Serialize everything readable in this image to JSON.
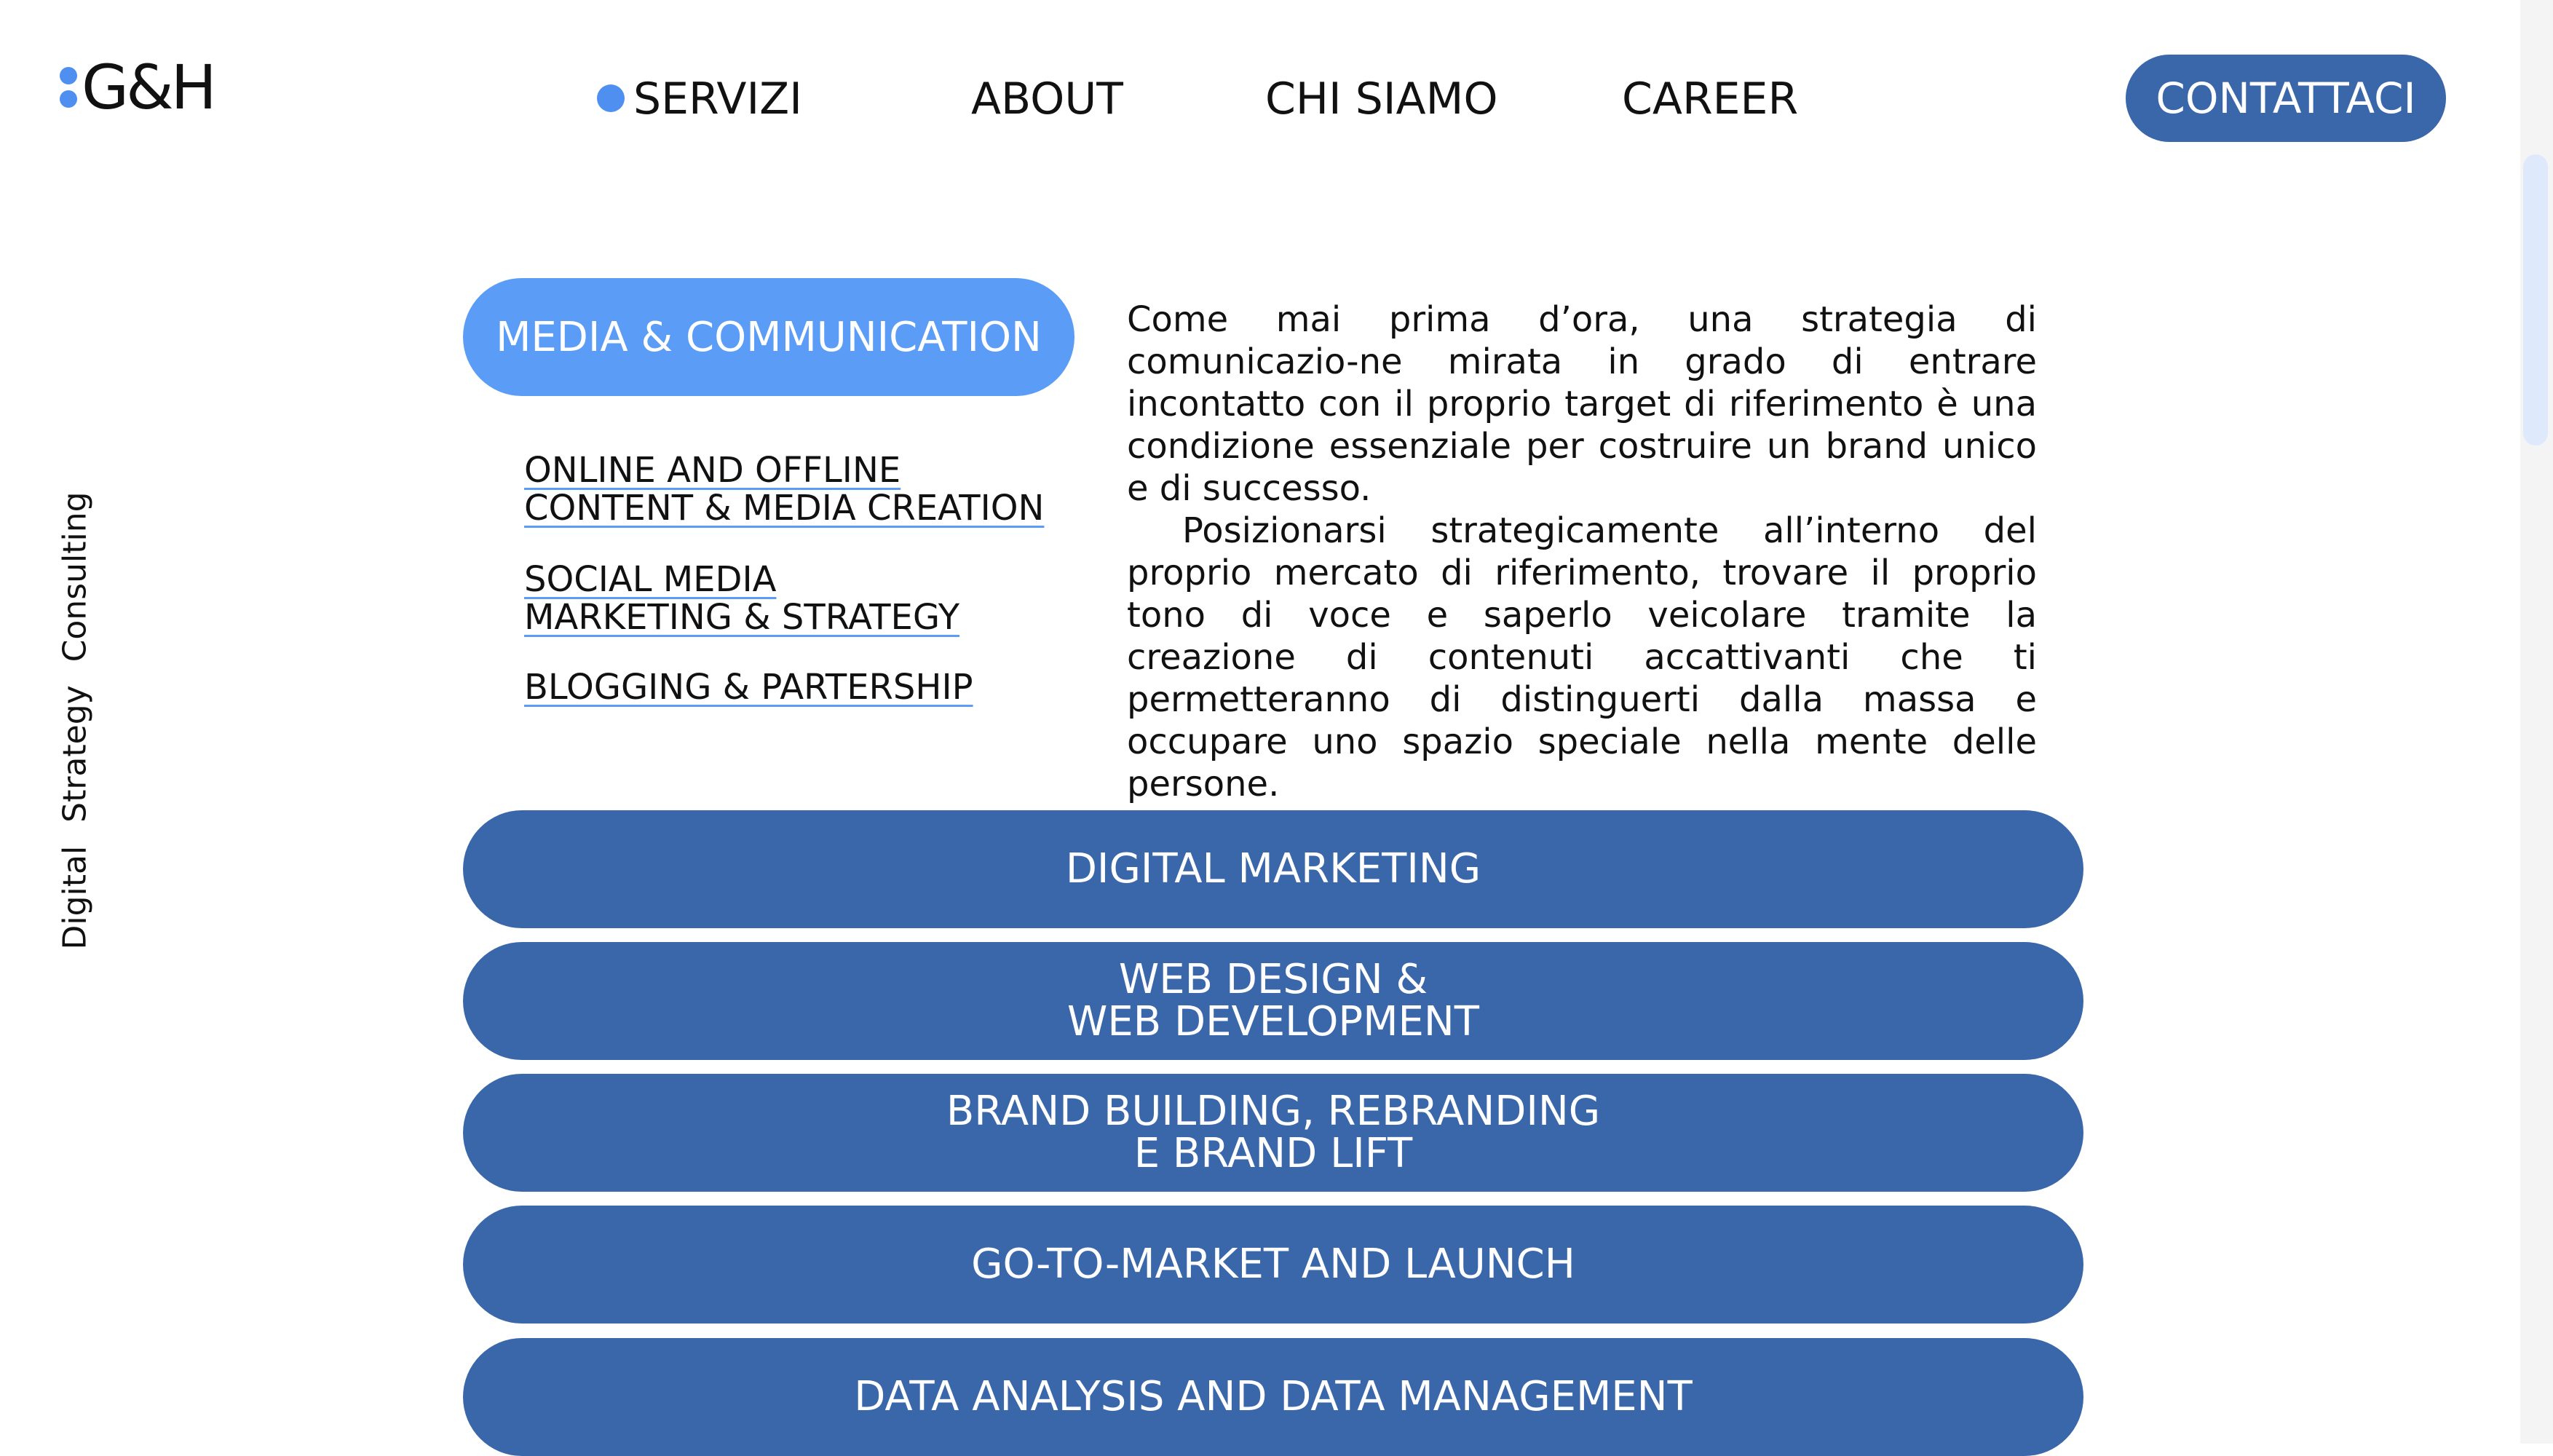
{
  "logo": {
    "text": "G&H"
  },
  "nav": {
    "items": [
      {
        "label": "SERVIZI",
        "active": true
      },
      {
        "label": "ABOUT"
      },
      {
        "label": "CHI SIAMO"
      },
      {
        "label": "CAREER"
      }
    ],
    "contact_label": "CONTATTACI"
  },
  "side_text": "Digital Strategy Consulting",
  "media": {
    "pill_label": "MEDIA & COMMUNICATION",
    "sublinks": [
      {
        "line1": "ONLINE AND OFFLINE",
        "line2": "CONTENT & MEDIA CREATION"
      },
      {
        "line1": "SOCIAL MEDIA",
        "line2": "MARKETING & STRATEGY"
      },
      {
        "line1": "BLOGGING & PARTERSHIP",
        "line2": ""
      }
    ],
    "description": [
      "Come mai prima d’ora, una strategia di comunicazio-ne mirata in grado di entrare incontatto con il proprio target di riferimento è una condizione essenziale per costruire un brand unico e di successo.",
      "Posizionarsi strategicamente all’interno del proprio mercato di riferimento, trovare il proprio tono di voce e saperlo veicolare tramite la creazione di contenuti accattivanti che ti permetteranno di distinguerti dalla massa e occupare uno spazio speciale nella mente delle persone."
    ]
  },
  "services": [
    "DIGITAL MARKETING",
    "WEB DESIGN &\nWEB DEVELOPMENT",
    "BRAND BUILDING, REBRANDING\nE BRAND LIFT",
    "GO-TO-MARKET AND LAUNCH",
    "DATA ANALYSIS AND DATA MANAGEMENT"
  ],
  "colors": {
    "accent_light": "#5b9cf6",
    "accent_dark": "#3a66aa",
    "dot": "#4f8ff0"
  }
}
